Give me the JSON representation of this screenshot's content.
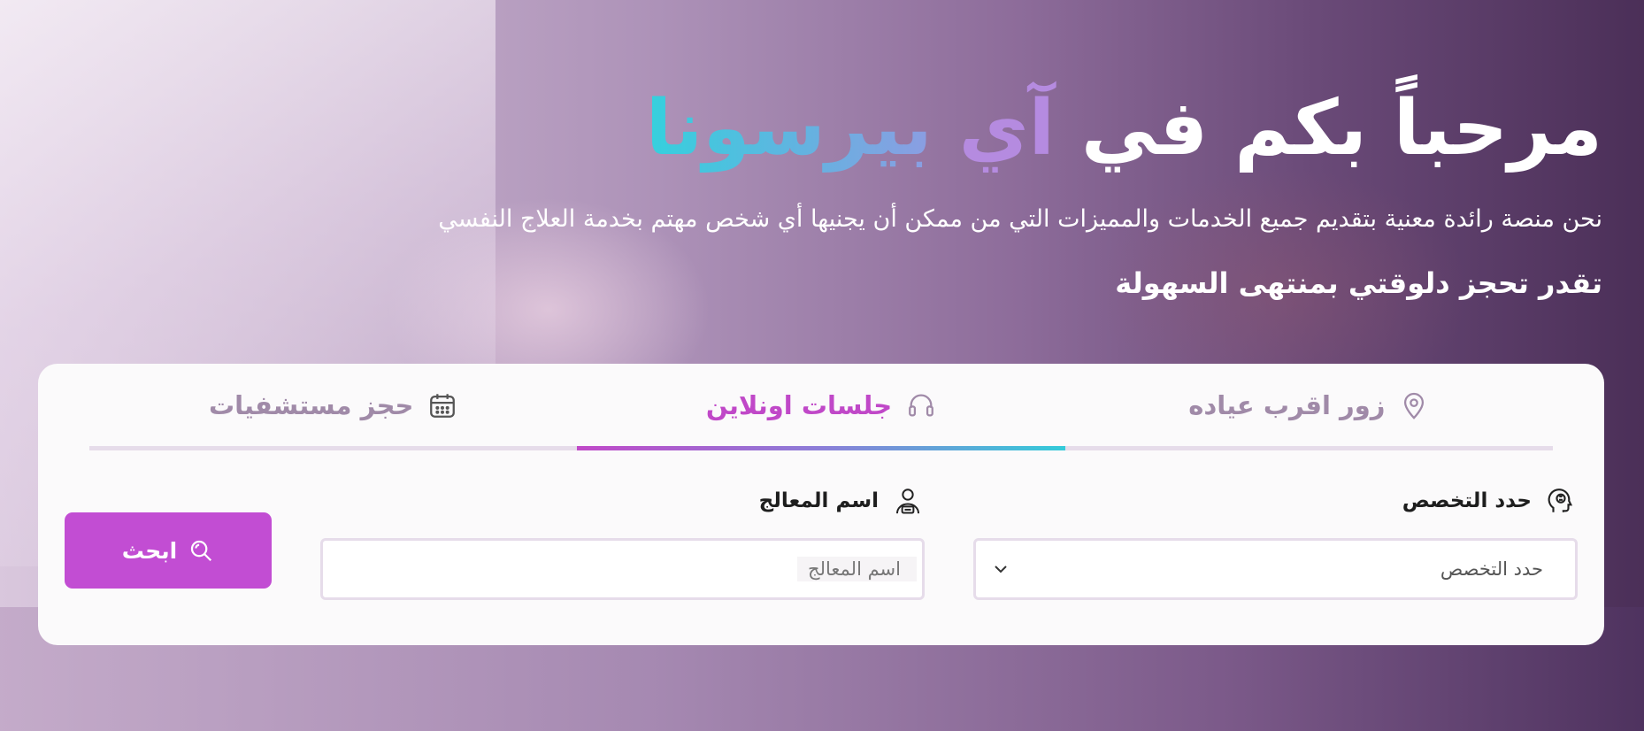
{
  "hero": {
    "title_prefix": "مرحباً بكم في",
    "brand_part1": "آي",
    "brand_part2": "بيرسونا",
    "subtitle": "نحن منصة رائدة معنية بتقديم جميع الخدمات والمميزات التي من ممكن أن يجنيها أي شخص مهتم بخدمة العلاج النفسي",
    "tagline": "تقدر تحجز دلوقتي بمنتهى السهولة"
  },
  "tabs": [
    {
      "label": "زور اقرب عياده",
      "icon": "location-pin-icon",
      "active": false
    },
    {
      "label": "جلسات اونلاين",
      "icon": "headphones-icon",
      "active": true
    },
    {
      "label": "حجز مستشفيات",
      "icon": "calendar-icon",
      "active": false
    }
  ],
  "form": {
    "specialty_label": "حدد التخصص",
    "specialty_value": "حدد التخصص",
    "specialty_icon": "brain-head-icon",
    "therapist_label": "اسم المعالج",
    "therapist_placeholder": "اسم المعالج",
    "therapist_icon": "therapist-icon",
    "search_label": "ابحث",
    "search_icon": "search-icon"
  },
  "colors": {
    "accent": "#c24dd3",
    "brand_purple": "#b58be0",
    "brand_cyan": "#34d1dd",
    "inactive_tab": "#a08aa8"
  }
}
